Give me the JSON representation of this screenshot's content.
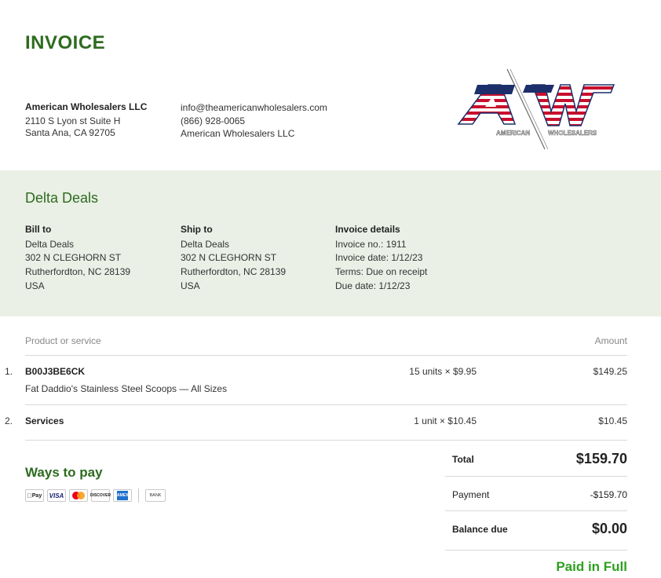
{
  "header": {
    "title": "INVOICE"
  },
  "company": {
    "name": "American Wholesalers LLC",
    "address_line1": "2110 S Lyon st Suite H",
    "address_line2": "Santa Ana, CA 92705",
    "email": "info@theamericanwholesalers.com",
    "phone": "(866) 928-0065",
    "website_name": "American Wholesalers LLC",
    "logo_text": "AW",
    "logo_tagline_left": "AMERICAN",
    "logo_tagline_right": "WHOLESALERS"
  },
  "client": {
    "name": "Delta Deals"
  },
  "bill_to": {
    "heading": "Bill to",
    "lines": [
      "Delta Deals",
      "302 N CLEGHORN ST",
      "Rutherfordton, NC 28139",
      "USA"
    ]
  },
  "ship_to": {
    "heading": "Ship to",
    "lines": [
      "Delta Deals",
      "302 N CLEGHORN ST",
      "Rutherfordton, NC 28139",
      "USA"
    ]
  },
  "invoice_details": {
    "heading": "Invoice details",
    "lines": [
      "Invoice no.: 1911",
      "Invoice date: 1/12/23",
      "Terms: Due on receipt",
      "Due date: 1/12/23"
    ]
  },
  "table": {
    "col_product": "Product or service",
    "col_amount": "Amount",
    "items": [
      {
        "number": "1.",
        "product": "B00J3BE6CK",
        "description": "Fat Daddio's Stainless Steel Scoops — All Sizes",
        "qty": "15 units × $9.95",
        "amount": "$149.25"
      },
      {
        "number": "2.",
        "product": "Services",
        "description": "",
        "qty": "1 unit × $10.45",
        "amount": "$10.45"
      }
    ]
  },
  "payment": {
    "heading": "Ways to pay",
    "methods": {
      "apple_pay": "Pay",
      "visa": "VISA",
      "discover": "DISCOVER",
      "amex": "AMEX",
      "bank": "BANK"
    }
  },
  "totals": {
    "total_label": "Total",
    "total_value": "$159.70",
    "payment_label": "Payment",
    "payment_value": "-$159.70",
    "balance_label": "Balance due",
    "balance_value": "$0.00",
    "status": "Paid in Full"
  },
  "colors": {
    "brand_green": "#2e6b1f",
    "band_bg": "#eaf0e6",
    "paid_green": "#2ea01f",
    "logo_red": "#c8102e",
    "logo_navy": "#1c2f6b"
  }
}
